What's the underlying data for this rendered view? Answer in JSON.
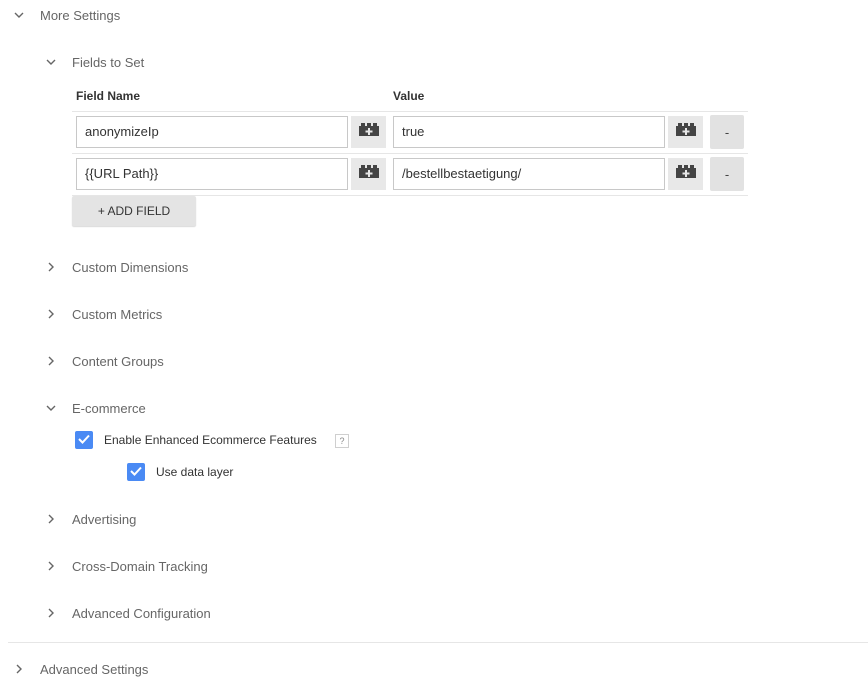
{
  "more_settings": {
    "label": "More Settings"
  },
  "fields_to_set": {
    "label": "Fields to Set",
    "col_field_name": "Field Name",
    "col_value": "Value",
    "rows": [
      {
        "field_name": "anonymizeIp",
        "value": "true",
        "remove_label": "-"
      },
      {
        "field_name": "{{URL Path}}",
        "value": "/bestellbestaetigung/",
        "remove_label": "-"
      }
    ],
    "add_field_label": "+ ADD FIELD"
  },
  "sections": {
    "custom_dimensions": "Custom Dimensions",
    "custom_metrics": "Custom Metrics",
    "content_groups": "Content Groups",
    "ecommerce": "E-commerce",
    "advertising": "Advertising",
    "cross_domain": "Cross-Domain Tracking",
    "advanced_configuration": "Advanced Configuration"
  },
  "ecommerce": {
    "enable_enhanced": {
      "label": "Enable Enhanced Ecommerce Features",
      "checked": true,
      "help": "?"
    },
    "use_data_layer": {
      "label": "Use data layer",
      "checked": true
    }
  },
  "advanced_settings": {
    "label": "Advanced Settings"
  },
  "colors": {
    "checkbox_accent": "#4a8af4",
    "button_bg": "#e4e4e4"
  }
}
